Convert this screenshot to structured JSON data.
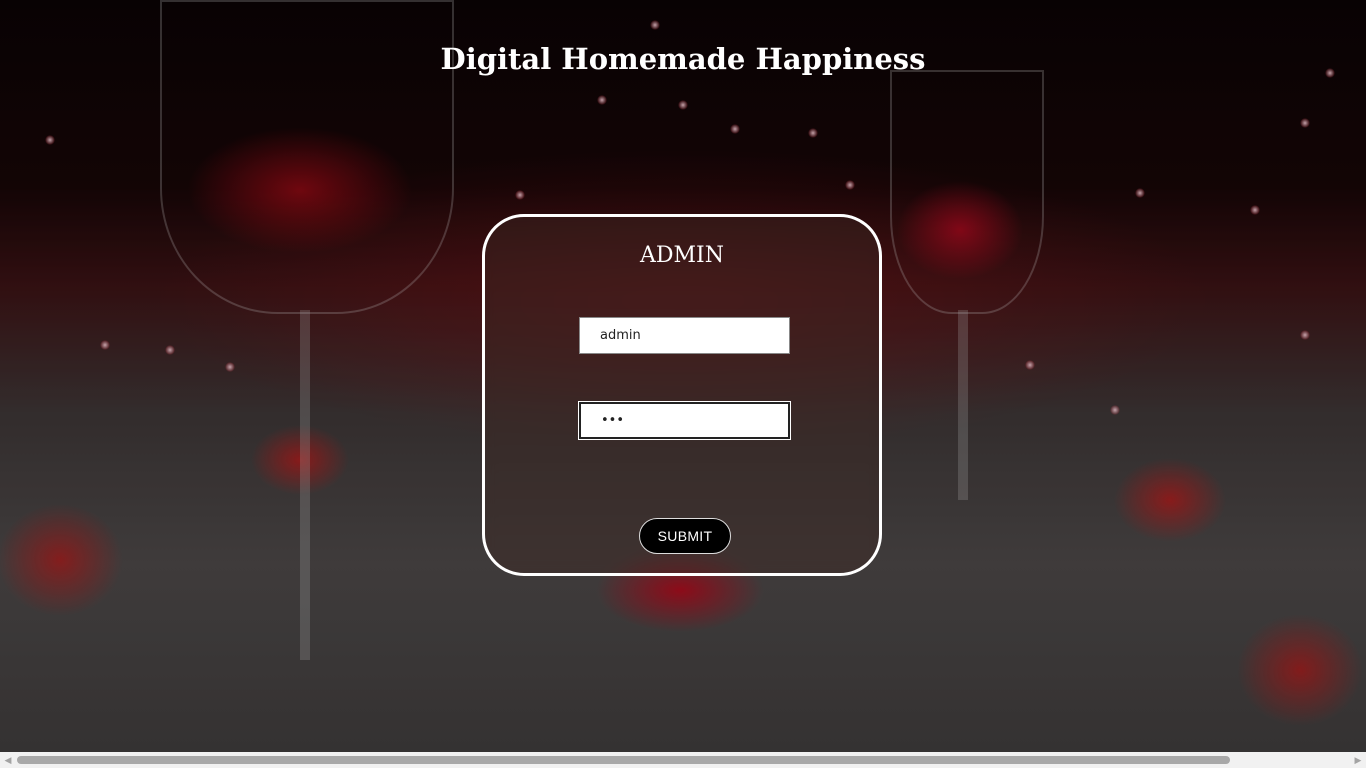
{
  "page": {
    "title": "Digital Homemade Happiness"
  },
  "login_card": {
    "heading": "ADMIN",
    "username_value": "admin",
    "password_value": "•••",
    "submit_label": "SUBMIT"
  },
  "scrollbar": {
    "left_arrow_icon": "chevron-left-icon",
    "right_arrow_icon": "chevron-right-icon",
    "left_arrow_glyph": "◀",
    "right_arrow_glyph": "▶"
  },
  "colors": {
    "card_border": "#ffffff",
    "submit_bg": "#000000",
    "title_text": "#ffffff"
  }
}
